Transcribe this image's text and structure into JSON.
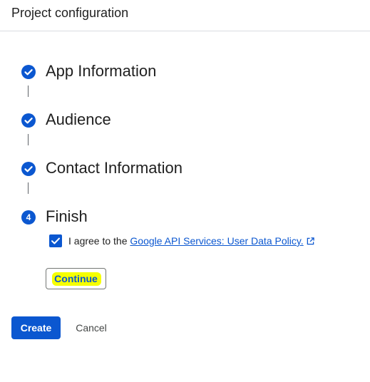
{
  "header": {
    "title": "Project configuration"
  },
  "steps": [
    {
      "label": "App Information",
      "status": "complete",
      "icon": "check-circle-icon"
    },
    {
      "label": "Audience",
      "status": "complete",
      "icon": "check-circle-icon"
    },
    {
      "label": "Contact Information",
      "status": "complete",
      "icon": "check-circle-icon"
    },
    {
      "label": "Finish",
      "status": "current",
      "number": "4"
    }
  ],
  "agreement": {
    "checked": true,
    "prefix": "I agree to the ",
    "link_text": "Google API Services: User Data Policy.",
    "link_icon": "open-in-new-icon"
  },
  "continue_label": "Continue",
  "actions": {
    "create_label": "Create",
    "cancel_label": "Cancel"
  },
  "colors": {
    "primary": "#0b57d0",
    "highlight": "#f6ff00",
    "divider": "#dadce0"
  }
}
